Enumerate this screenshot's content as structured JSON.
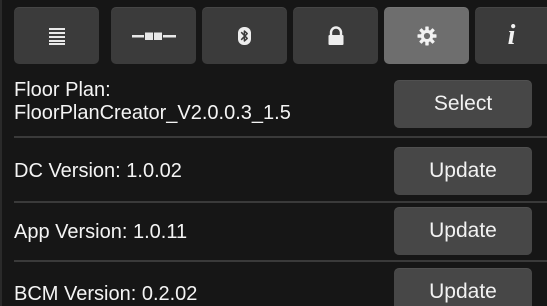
{
  "tabs": [
    {
      "icon": "list-icon",
      "active": false
    },
    {
      "icon": "connection-icon",
      "active": false
    },
    {
      "icon": "bluetooth-icon",
      "active": false
    },
    {
      "icon": "lock-icon",
      "active": false
    },
    {
      "icon": "gear-icon",
      "active": true
    },
    {
      "icon": "info-icon",
      "active": false,
      "glyph": "i"
    }
  ],
  "rows": [
    {
      "label_line1": "Floor Plan:",
      "label_line2": "FloorPlanCreator_V2.0.0.3_1.5",
      "button": "Select"
    },
    {
      "label": "DC Version:  1.0.02",
      "button": "Update"
    },
    {
      "label": "App Version:  1.0.11",
      "button": "Update"
    },
    {
      "label": "BCM Version:  0.2.02",
      "button": "Update"
    }
  ],
  "colors": {
    "background": "#161616",
    "tab": "#3b3b3b",
    "tab_active": "#6e6e6e",
    "button": "#474747",
    "divider": "#3a3a3a",
    "text": "#f4f4f4"
  }
}
